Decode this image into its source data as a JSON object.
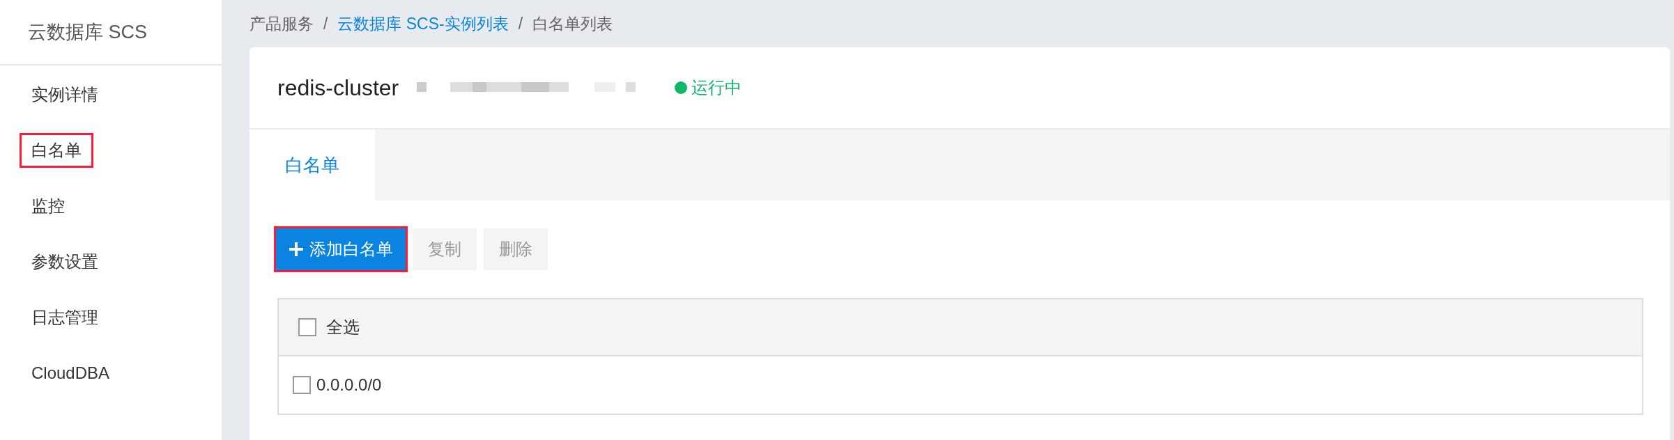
{
  "sidebar": {
    "title": "云数据库 SCS",
    "items": [
      {
        "label": "实例详情",
        "annotated": false
      },
      {
        "label": "白名单",
        "annotated": true
      },
      {
        "label": "监控",
        "annotated": false
      },
      {
        "label": "参数设置",
        "annotated": false
      },
      {
        "label": "日志管理",
        "annotated": false
      },
      {
        "label": "CloudDBA",
        "annotated": false
      }
    ]
  },
  "breadcrumb": [
    {
      "label": "产品服务",
      "kind": "text"
    },
    {
      "label": "/",
      "kind": "separator"
    },
    {
      "label": "云数据库 SCS-实例列表",
      "kind": "link"
    },
    {
      "label": "/",
      "kind": "separator"
    },
    {
      "label": "白名单列表",
      "kind": "text"
    }
  ],
  "instance": {
    "name": "redis-cluster",
    "status": {
      "label": "运行中",
      "color": "#12b76a"
    }
  },
  "tabs": [
    {
      "label": "白名单",
      "selected": true
    }
  ],
  "toolbar": [
    {
      "label": "添加白名单",
      "kind": "primary",
      "annotated": true,
      "disabled": false
    },
    {
      "label": "复制",
      "kind": "default",
      "annotated": false,
      "disabled": true
    },
    {
      "label": "删除",
      "kind": "default",
      "annotated": false,
      "disabled": true
    }
  ],
  "table": {
    "header": {
      "label": "全选",
      "checked": false
    },
    "rows": [
      {
        "ip": "0.0.0.0/0",
        "checked": false
      }
    ]
  }
}
